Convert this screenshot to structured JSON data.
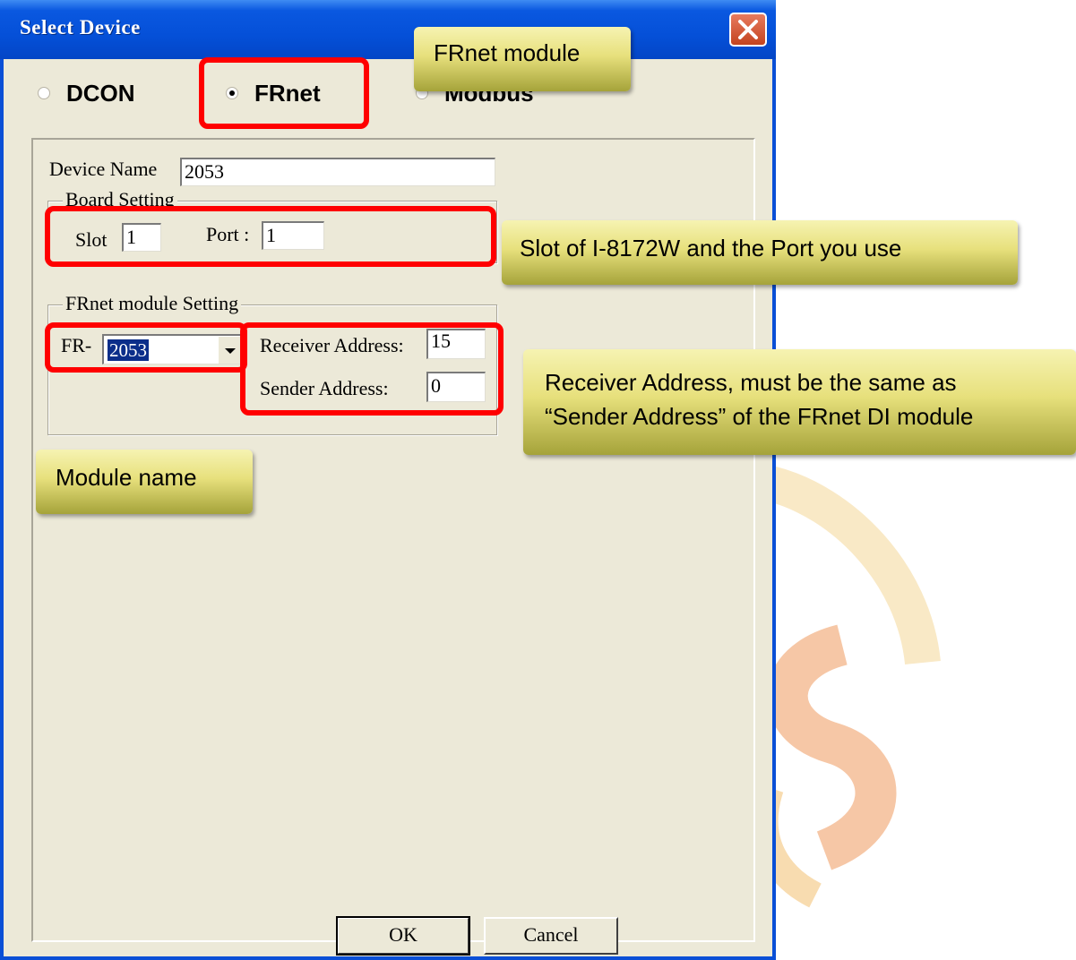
{
  "window": {
    "title": "Select Device"
  },
  "protocols": [
    {
      "label": "DCON",
      "selected": false
    },
    {
      "label": "FRnet",
      "selected": true
    },
    {
      "label": "Modbus",
      "selected": false
    }
  ],
  "form": {
    "device_name_label": "Device Name",
    "device_name_value": "2053",
    "board_setting_legend": "Board Setting",
    "slot_label": "Slot",
    "slot_value": "1",
    "port_label": "Port :",
    "port_value": "1",
    "frnet_setting_legend": "FRnet module Setting",
    "fr_prefix": "FR-",
    "module_selected": "2053",
    "receiver_address_label": "Receiver Address:",
    "receiver_address_value": "15",
    "sender_address_label": "Sender Address:",
    "sender_address_value": "0"
  },
  "buttons": {
    "ok": "OK",
    "cancel": "Cancel"
  },
  "callouts": {
    "frnet_module": "FRnet module",
    "slot_port": "Slot of I-8172W and the Port you use",
    "receiver_line1": "Receiver Address, must be the same as",
    "receiver_line2": "“Sender Address” of the FRnet DI module",
    "module_name": "Module name"
  },
  "colors": {
    "titlebar": "#0550d8",
    "highlight": "#ff0000",
    "callout": "#e7e07c",
    "dialog_bg": "#ece9d8"
  }
}
